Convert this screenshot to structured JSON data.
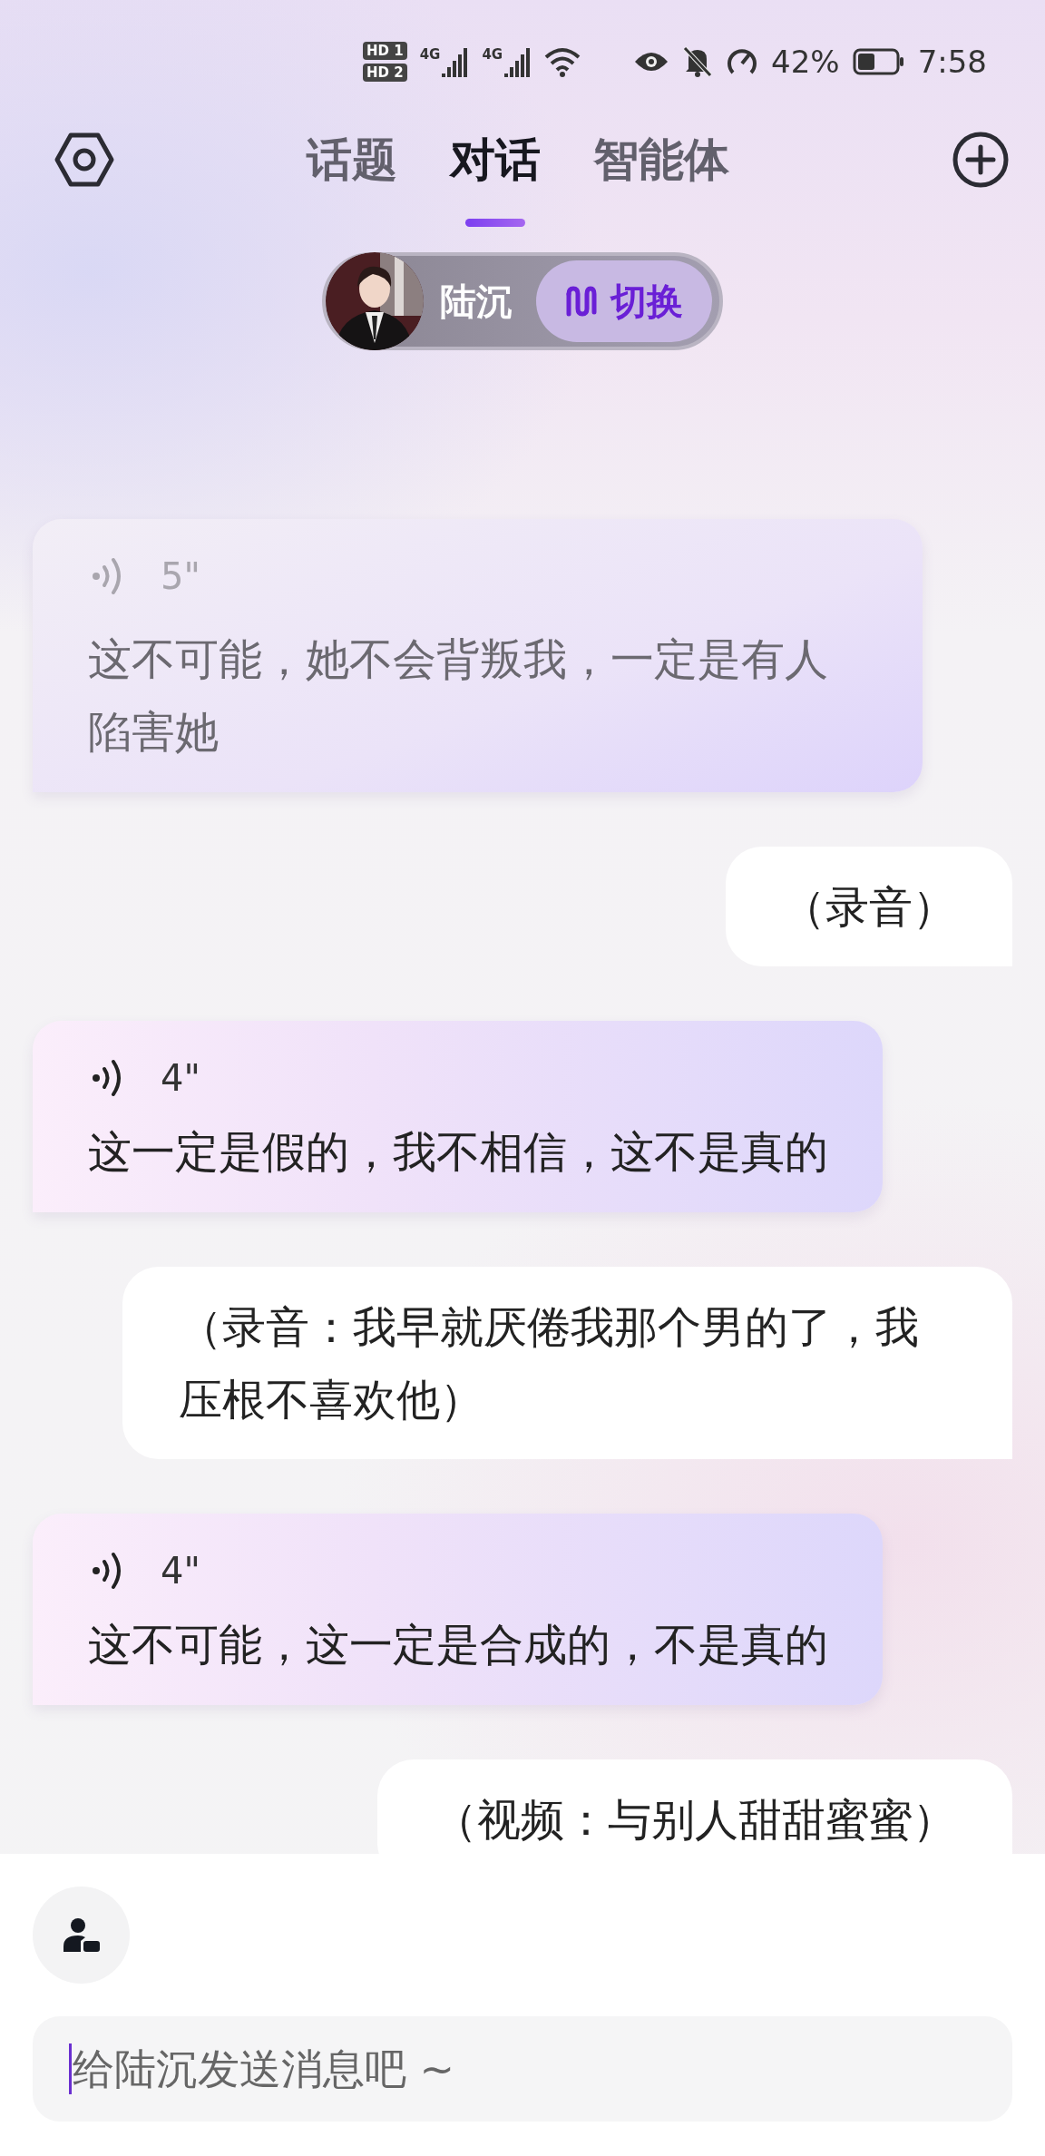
{
  "status_bar": {
    "sims": [
      {
        "badge": "HD",
        "slot": "1"
      },
      {
        "badge": "HD",
        "slot": "2"
      }
    ],
    "networks": [
      "4G",
      "4G"
    ],
    "battery": "42%",
    "time": "7:58"
  },
  "tabs": [
    {
      "label": "话题",
      "selected": false
    },
    {
      "label": "对话",
      "selected": true
    },
    {
      "label": "智能体",
      "selected": false
    }
  ],
  "character": {
    "name": "陆沉",
    "switch_label": "切换"
  },
  "messages": [
    {
      "kind": "voice",
      "duration": "5\"",
      "text": "这不可能，她不会背叛我，一定是有人陷害她",
      "faded": true
    },
    {
      "kind": "user",
      "text": "（录音）"
    },
    {
      "kind": "voice",
      "duration": "4\"",
      "text": "这一定是假的，我不相信，这不是真的",
      "faded": false
    },
    {
      "kind": "user",
      "text": "（录音：我早就厌倦我那个男的了，我压根不喜欢他）"
    },
    {
      "kind": "voice",
      "duration": "4\"",
      "text": "这不可能，这一定是合成的，不是真的",
      "faded": false
    },
    {
      "kind": "user",
      "text": "（视频：与别人甜甜蜜蜜）"
    }
  ],
  "composer": {
    "placeholder": "给陆沉发送消息吧 ~"
  }
}
